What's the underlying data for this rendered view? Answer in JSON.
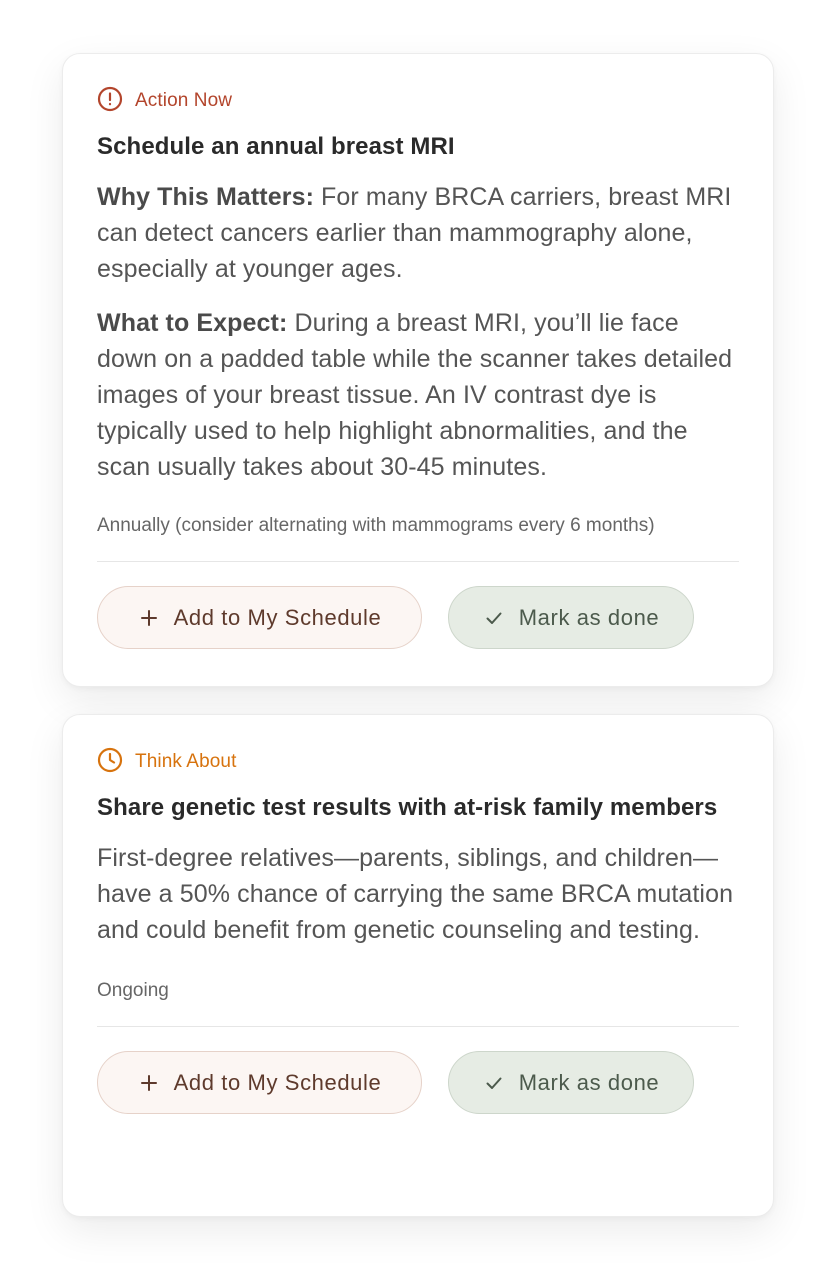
{
  "cards": [
    {
      "badge": {
        "label": "Action Now",
        "icon": "alert-circle-icon",
        "color": "#b3452c"
      },
      "title": "Schedule an annual breast MRI",
      "why": {
        "label": "Why This Matters:",
        "text": " For many BRCA carriers, breast MRI can detect cancers earlier than mammography alone, especially at younger ages."
      },
      "expect": {
        "label": "What to Expect:",
        "text": " During a breast MRI, you’ll lie face down on a padded table while the scanner takes detailed images of your breast tissue. An IV contrast dye is typically used to help highlight abnormalities, and the scan usually takes about 30-45 minutes."
      },
      "frequency": "Annually (consider alternating with mammograms every 6 months)",
      "buttons": {
        "add_label": "Add to My Schedule",
        "add_icon": "plus-icon",
        "done_label": "Mark as done",
        "done_icon": "check-icon"
      }
    },
    {
      "badge": {
        "label": "Think About",
        "icon": "clock-icon",
        "color": "#d7730e"
      },
      "title": "Share genetic test results with at-risk family members",
      "description": "First-degree relatives—parents, siblings, and children—have a 50% chance of carrying the same BRCA mutation and could benefit from genetic counseling and testing.",
      "frequency": "Ongoing",
      "buttons": {
        "add_label": "Add to My Schedule",
        "add_icon": "plus-icon",
        "done_label": "Mark as done",
        "done_icon": "check-icon"
      }
    }
  ]
}
